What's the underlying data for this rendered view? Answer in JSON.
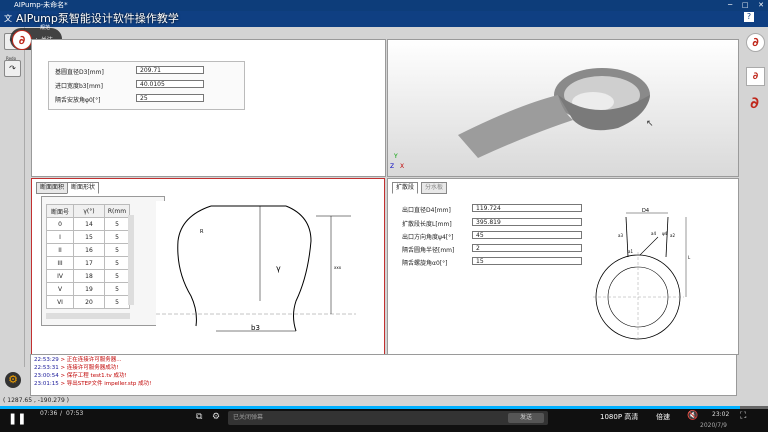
{
  "window": {
    "title": "AIPump-未命名*",
    "minimize_icon": "minimize-icon",
    "maximize_icon": "maximize-icon",
    "close_icon": "close-icon"
  },
  "video_title": "AIPump泵智能设计软件操作教学",
  "menu": {
    "file_label": "文",
    "help_icon": "help-icon"
  },
  "uploader": {
    "follow_label": "+ 关注",
    "badge_label": "规范"
  },
  "left_toolbar": {
    "items": [
      {
        "icon": "pencil-icon",
        "label": ""
      },
      {
        "icon": "redo-icon",
        "label": "Redo"
      }
    ]
  },
  "top_params": [
    {
      "label": "基圆直径D3[mm]",
      "value": "209.71"
    },
    {
      "label": "进口宽度b3[mm]",
      "value": "40.0105"
    },
    {
      "label": "隔舌安放角φ0[°]",
      "value": "25"
    }
  ],
  "section_tabs": [
    "断面面积",
    "断面形状"
  ],
  "section_table": {
    "headers": [
      "断面号",
      "γ(°)",
      "R(mm"
    ],
    "rows": [
      [
        "0",
        "14",
        "5"
      ],
      [
        "I",
        "15",
        "5"
      ],
      [
        "II",
        "16",
        "5"
      ],
      [
        "III",
        "17",
        "5"
      ],
      [
        "IV",
        "18",
        "5"
      ],
      [
        "V",
        "19",
        "5"
      ],
      [
        "VI",
        "20",
        "5"
      ]
    ]
  },
  "section_drawing": {
    "gamma_label": "γ",
    "b3_label": "b3",
    "r_label": "R",
    "dim_label": "xxx"
  },
  "diffuser_tabs": [
    "扩散段",
    "分水板"
  ],
  "diffuser_params": [
    {
      "label": "出口直径D4[mm]",
      "value": "119.724"
    },
    {
      "label": "扩散段长度L[mm]",
      "value": "395.819"
    },
    {
      "label": "出口方向角度ψ4[°]",
      "value": "45"
    },
    {
      "label": "隔舌圆角半径[mm]",
      "value": "2"
    },
    {
      "label": "隔舌螺旋角α0[°]",
      "value": "15"
    }
  ],
  "diffuser_drawing": {
    "d4_label": "D4",
    "labels": [
      "a3",
      "a4",
      "a1",
      "ψ4",
      "a2",
      "L"
    ]
  },
  "log": [
    {
      "time": "22:53:29",
      "text": "> 正在连接许可服务器..."
    },
    {
      "time": "22:53:31",
      "text": "> 连接许可服务器成功!"
    },
    {
      "time": "23:00:54",
      "text": "> 保存工程 test1.tv 成功!"
    },
    {
      "time": "23:01:15",
      "text": "> 导出STEP文件 impeller.stp 成功!"
    }
  ],
  "status": {
    "coords": "( 1287.65 , -190.279 )"
  },
  "player": {
    "current_time": "07:36",
    "total_time": "07:53",
    "progress": 0.963,
    "danmaku_placeholder": "已关闭弹幕",
    "send_label": "发送",
    "quality_label": "1080P 高清",
    "speed_label": "倍速",
    "date_label": "2020/7/9",
    "clock_label": "23:02"
  },
  "colors": {
    "log_time": "#1a1a9a",
    "log_msg": "#c00000",
    "accent": "#00b0ff",
    "brand_red": "#c0281c"
  }
}
